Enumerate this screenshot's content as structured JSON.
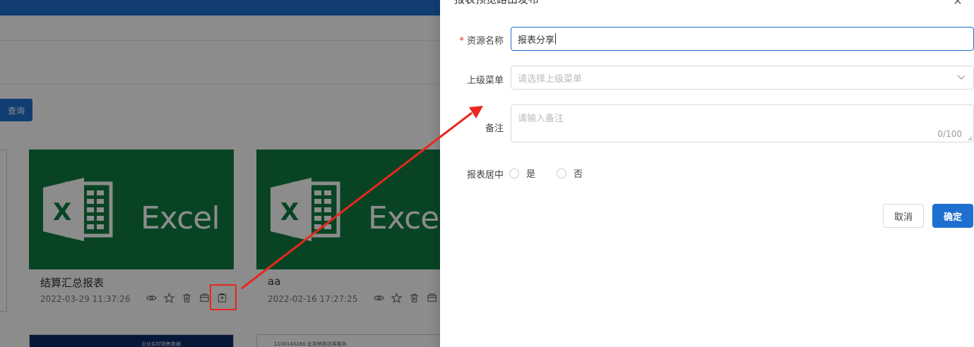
{
  "background": {
    "query_button": "查询",
    "cards": [
      {
        "title": "结算汇总报表",
        "date": "2022-03-29 11:37:26",
        "logo_text": "Excel"
      },
      {
        "title": "aa",
        "date": "2022-02-16 17:27:25",
        "logo_text": "Excel"
      }
    ],
    "mini_cards": [
      {
        "text": "企业实时销售数据"
      },
      {
        "text": "1100143180    北京地铁站客服务"
      }
    ],
    "card_actions": [
      "eye-icon",
      "star-icon",
      "trash-icon",
      "archive-icon",
      "publish-icon"
    ]
  },
  "drawer": {
    "title": "报表预览路由发布",
    "close_icon": "close-icon",
    "form": {
      "resource_name": {
        "label": "资源名称",
        "required_mark": "*",
        "value": "报表分享"
      },
      "parent_menu": {
        "label": "上级菜单",
        "placeholder": "请选择上级菜单"
      },
      "remark": {
        "label": "备注",
        "placeholder": "请输入备注",
        "counter": "0/100"
      },
      "center": {
        "label": "报表居中",
        "options": [
          "是",
          "否"
        ]
      }
    },
    "cancel_label": "取消",
    "ok_label": "确定"
  },
  "colors": {
    "primary": "#1f6fd1",
    "excel_green": "#107c41",
    "annotation_red": "#e8271d"
  }
}
